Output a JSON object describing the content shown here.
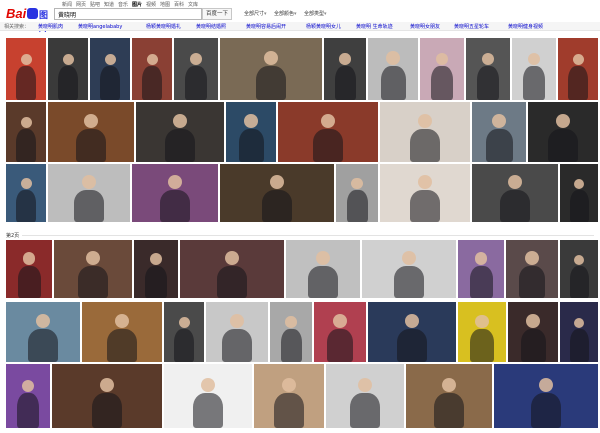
{
  "topnav": {
    "items": [
      "新闻",
      "网页",
      "贴吧",
      "知道",
      "音乐",
      "图片",
      "视频",
      "地图",
      "百科",
      "文库"
    ],
    "active_index": 5
  },
  "logo": {
    "text_bai": "Bai",
    "text_du": "图片"
  },
  "search": {
    "value": "黄晓明",
    "button": "百度一下"
  },
  "filters": [
    {
      "label": "全部尺寸",
      "icon": "chevron-down-icon"
    },
    {
      "label": "全部颜色",
      "icon": "chevron-down-icon"
    },
    {
      "label": "全部类型",
      "icon": "chevron-down-icon"
    }
  ],
  "related": {
    "label": "相关搜索：",
    "items": [
      "黄晓明肌肉",
      "黄晓明angelababy",
      "杨颖黄晓明婚礼",
      "黄晓明结婚照",
      "黄晓明容易后闹开",
      "杨颖黄晓明女儿",
      "黄晓明 生命轨迹",
      "黄晓明女朋友",
      "黄晓明五星轮车",
      "黄晓明健身视频"
    ]
  },
  "page2": {
    "label": "第2页"
  },
  "colors": {
    "accent": "#2932e1",
    "brand_red": "#e10601",
    "link": "#0000cc"
  }
}
